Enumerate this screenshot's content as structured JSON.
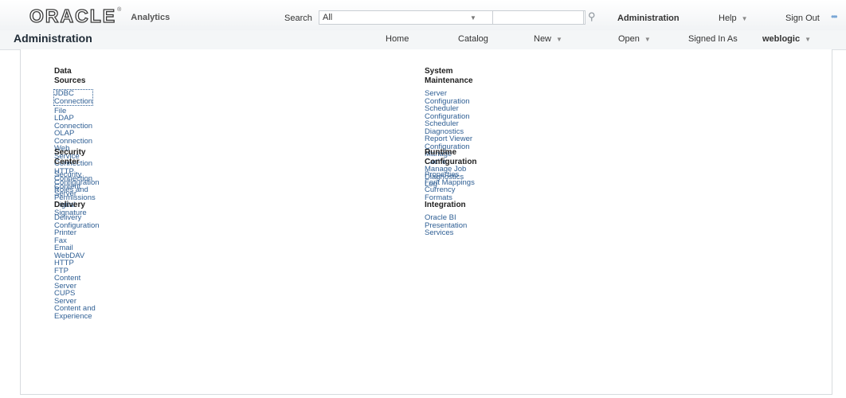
{
  "topbar": {
    "logo_word": "ORACLE",
    "logo_mark": "®",
    "product": "Analytics",
    "search_label": "Search",
    "search_scope": "All",
    "search_placeholder": "",
    "links": {
      "administration": "Administration",
      "help": "Help",
      "sign_out": "Sign Out"
    }
  },
  "header": {
    "title": "Administration",
    "nav": {
      "home": "Home",
      "catalog": "Catalog",
      "new": "New",
      "open": "Open",
      "signed_in_as": "Signed In As",
      "user": "weblogic"
    }
  },
  "left_column": [
    {
      "title": "Data Sources",
      "links": [
        "JDBC Connection",
        "File",
        "LDAP Connection",
        "OLAP Connection",
        "Web Service Connection",
        "HTTP Connection",
        "Content Server"
      ]
    },
    {
      "title": "Security Center",
      "links": [
        "Security Configuration",
        "Roles and Permissions",
        "Digital Signature"
      ]
    },
    {
      "title": "Delivery",
      "links": [
        "Delivery Configuration",
        "Printer",
        "Fax",
        "Email",
        "WebDAV",
        "HTTP",
        "FTP",
        "Content Server",
        "CUPS Server",
        "Content and Experience"
      ]
    }
  ],
  "right_column": [
    {
      "title": "System Maintenance",
      "links": [
        "Server Configuration",
        "Scheduler Configuration",
        "Scheduler Diagnostics",
        "Report Viewer Configuration",
        "Manage Cache",
        "Manage Job Diagnostics Log"
      ]
    },
    {
      "title": "Runtime Configuration",
      "links": [
        "Properties",
        "Font Mappings",
        "Currency Formats"
      ]
    },
    {
      "title": "Integration",
      "links": [
        "Oracle BI Presentation Services"
      ]
    }
  ],
  "colors": {
    "link": "#2f5f94",
    "title": "#1f2b36"
  }
}
